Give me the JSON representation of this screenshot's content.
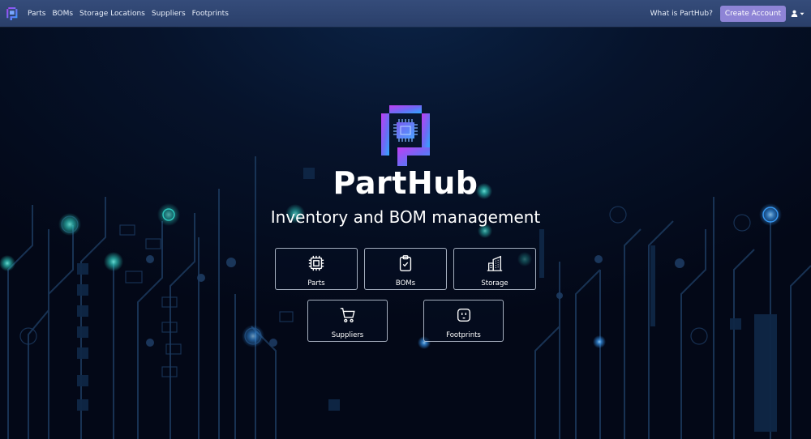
{
  "app": {
    "name": "PartHub"
  },
  "navbar": {
    "links": [
      {
        "label": "Parts"
      },
      {
        "label": "BOMs"
      },
      {
        "label": "Storage Locations"
      },
      {
        "label": "Suppliers"
      },
      {
        "label": "Footprints"
      }
    ],
    "what_link": "What is PartHub?",
    "create_button": "Create Account",
    "user_icon": "user-icon",
    "caret_icon": "caret-down-icon"
  },
  "hero": {
    "title": "PartHub",
    "subtitle": "Inventory and BOM management"
  },
  "cards": [
    {
      "label": "Parts",
      "icon": "chip-icon"
    },
    {
      "label": "BOMs",
      "icon": "clipboard-check-icon"
    },
    {
      "label": "Storage",
      "icon": "building-icon"
    },
    {
      "label": "Suppliers",
      "icon": "cart-icon"
    },
    {
      "label": "Footprints",
      "icon": "outlet-icon"
    }
  ],
  "colors": {
    "navbar": "#2f4573",
    "button": "#8e84d6",
    "background": "#040a1c",
    "glow": "#2fd0c4",
    "logo_gradient_start": "#b23cf0",
    "logo_gradient_end": "#2fa3ff"
  }
}
